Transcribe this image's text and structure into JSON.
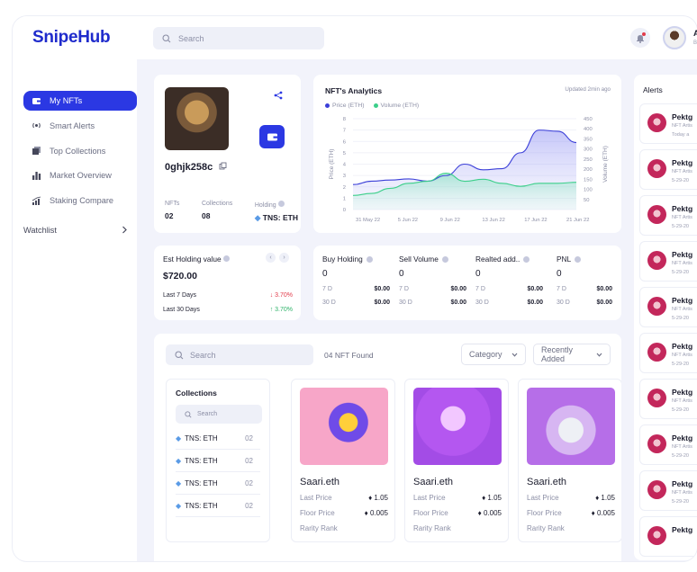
{
  "app": {
    "logo": "SnipeHub"
  },
  "nav": {
    "items": [
      {
        "label": "My NFTs",
        "icon": "wallet-icon",
        "active": true
      },
      {
        "label": "Smart Alerts",
        "icon": "broadcast-icon"
      },
      {
        "label": "Top Collections",
        "icon": "collections-icon"
      },
      {
        "label": "Market Overview",
        "icon": "bar-chart-icon"
      },
      {
        "label": "Staking Compare",
        "icon": "staking-chart-icon"
      }
    ],
    "watchlist": "Watchlist"
  },
  "topbar": {
    "search_placeholder": "Search",
    "user_initial": "A",
    "user_sub": "B"
  },
  "profile": {
    "address": "0ghjk258c",
    "stats": [
      {
        "label": "NFTs",
        "value": "02"
      },
      {
        "label": "Collections",
        "value": "08"
      },
      {
        "label": "Holding",
        "value": "TNS: ETH"
      }
    ]
  },
  "analytics": {
    "title": "NFT's Analytics",
    "updated": "Updated 2min ago",
    "legend": [
      "Price (ETH)",
      "Volume (ETH)"
    ],
    "colors": {
      "price": "#3b3fd8",
      "volume": "#3ccf8a"
    }
  },
  "chart_data": {
    "type": "area",
    "x": [
      "31 May 22",
      "5 Jun 22",
      "9 Jun 22",
      "13 Jun 22",
      "17 Jun 22",
      "21 Jun 22"
    ],
    "y_left_ticks": [
      0,
      1,
      2,
      3,
      4,
      5,
      6,
      7,
      8
    ],
    "y_right_ticks": [
      50,
      100,
      150,
      200,
      250,
      300,
      350,
      400,
      450
    ],
    "ylabel_left": "Price (ETH)",
    "ylabel_right": "Volume (ETH)",
    "series": [
      {
        "name": "Price (ETH)",
        "axis": "left",
        "values": [
          2.2,
          2.5,
          2.6,
          2.7,
          2.5,
          3.0,
          4.0,
          3.5,
          3.6,
          5.0,
          7.0,
          6.9,
          5.9
        ]
      },
      {
        "name": "Volume (ETH)",
        "axis": "right",
        "values": [
          70,
          80,
          105,
          130,
          140,
          180,
          140,
          150,
          130,
          115,
          130,
          130,
          135
        ]
      }
    ]
  },
  "holding": {
    "title": "Est Holding value",
    "value": "$720.00",
    "rows": [
      {
        "label": "Last 7 Days",
        "change": "↓ 3.70%",
        "color": "#e23b4a"
      },
      {
        "label": "Last 30 Days",
        "change": "↑ 3.70%",
        "color": "#2fb36a"
      }
    ]
  },
  "metrics": [
    {
      "title": "Buy Holding",
      "value": "0",
      "r1": [
        "7 D",
        "$0.00"
      ],
      "r2": [
        "30 D",
        "$0.00"
      ]
    },
    {
      "title": "Sell Volume",
      "value": "0",
      "r1": [
        "7 D",
        "$0.00"
      ],
      "r2": [
        "30 D",
        "$0.00"
      ]
    },
    {
      "title": "Realted add..",
      "value": "0",
      "r1": [
        "7 D",
        "$0.00"
      ],
      "r2": [
        "30 D",
        "$0.00"
      ]
    },
    {
      "title": "PNL",
      "value": "0",
      "r1": [
        "7 D",
        "$0.00"
      ],
      "r2": [
        "30 D",
        "$0.00"
      ]
    }
  ],
  "nftPanel": {
    "search_placeholder": "Search",
    "found": "04 NFT Found",
    "category": "Category",
    "sort": "Recently Added",
    "collections_title": "Collections",
    "collections_search": "Search",
    "collections": [
      {
        "name": "TNS: ETH",
        "count": "02"
      },
      {
        "name": "TNS: ETH",
        "count": "02"
      },
      {
        "name": "TNS: ETH",
        "count": "02"
      },
      {
        "name": "TNS: ETH",
        "count": "02"
      }
    ],
    "cards": [
      {
        "name": "Saari.eth",
        "last_label": "Last Price",
        "last": "1.05",
        "floor_label": "Floor Price",
        "floor": "0.005",
        "rarity_label": "Rarity Rank"
      },
      {
        "name": "Saari.eth",
        "last_label": "Last Price",
        "last": "1.05",
        "floor_label": "Floor Price",
        "floor": "0.005",
        "rarity_label": "Rarity Rank"
      },
      {
        "name": "Saari.eth",
        "last_label": "Last Price",
        "last": "1.05",
        "floor_label": "Floor Price",
        "floor": "0.005",
        "rarity_label": "Rarity Rank"
      }
    ]
  },
  "alerts": {
    "title": "Alerts",
    "items": [
      {
        "name": "Pektg",
        "sub": "NFT Artis",
        "time": "Today a"
      },
      {
        "name": "Pektg",
        "sub": "NFT Artis",
        "time": "5-29-20"
      },
      {
        "name": "Pektg",
        "sub": "NFT Artis",
        "time": "5-29-20"
      },
      {
        "name": "Pektg",
        "sub": "NFT Artis",
        "time": "5-29-20"
      },
      {
        "name": "Pektg",
        "sub": "NFT Artis",
        "time": "5-29-20"
      },
      {
        "name": "Pektg",
        "sub": "NFT Artis",
        "time": "5-29-20"
      },
      {
        "name": "Pektg",
        "sub": "NFT Artis",
        "time": "5-29-20"
      },
      {
        "name": "Pektg",
        "sub": "NFT Artis",
        "time": "5-29-20"
      },
      {
        "name": "Pektg",
        "sub": "NFT Artis",
        "time": "5-29-20"
      },
      {
        "name": "Pektg",
        "sub": "",
        "time": ""
      }
    ]
  }
}
